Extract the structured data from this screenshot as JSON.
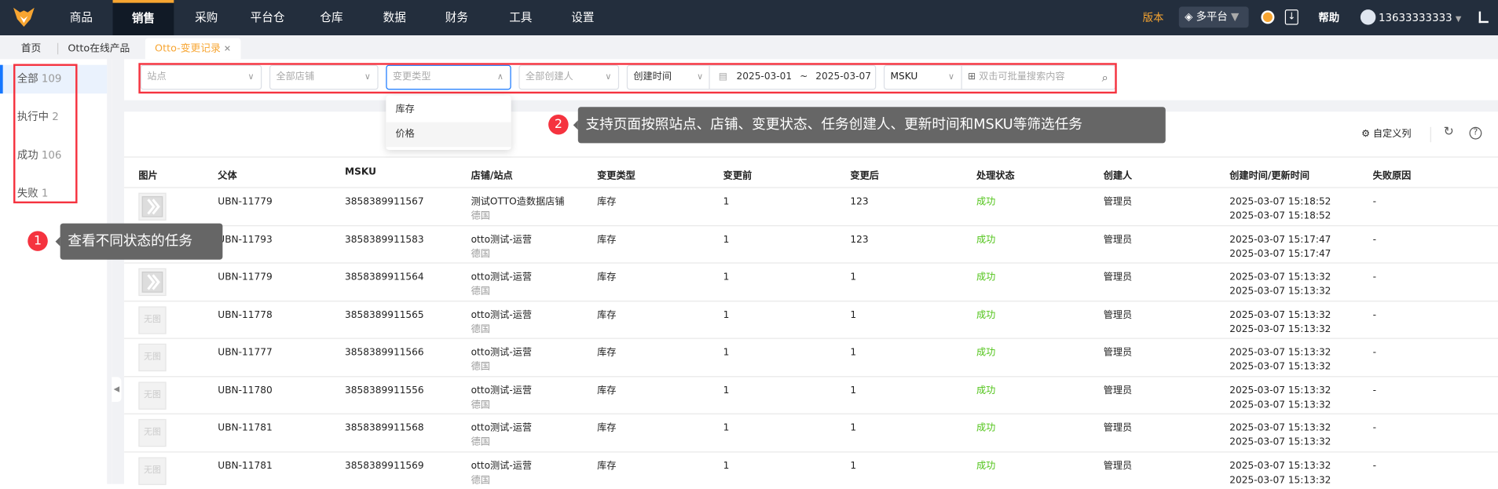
{
  "nav": {
    "items": [
      "商品",
      "销售",
      "采购",
      "平台仓",
      "仓库",
      "数据",
      "财务",
      "工具",
      "设置"
    ],
    "active": 1,
    "version": "版本",
    "platform": "多平台",
    "help": "帮助",
    "user": "13633333333"
  },
  "tabs": [
    {
      "label": "首页"
    },
    {
      "label": "Otto在线产品"
    },
    {
      "label": "Otto-变更记录",
      "close": "✕"
    }
  ],
  "sidebar": [
    {
      "label": "全部",
      "count": "109"
    },
    {
      "label": "执行中",
      "count": "2"
    },
    {
      "label": "成功",
      "count": "106"
    },
    {
      "label": "失败",
      "count": "1"
    }
  ],
  "filters": {
    "site": "站点",
    "store": "全部店铺",
    "type": "变更类型",
    "creator": "全部创建人",
    "time_type": "创建时间",
    "date_from": "2025-03-01",
    "date_sep": "~",
    "date_to": "2025-03-07",
    "search_field": "MSKU",
    "search_placeholder": "双击可批量搜索内容"
  },
  "dropdown": [
    "库存",
    "价格"
  ],
  "annotations": [
    {
      "num": "1",
      "text": "查看不同状态的任务"
    },
    {
      "num": "2",
      "text": "支持页面按照站点、店铺、变更状态、任务创建人、更新时间和MSKU等筛选任务"
    }
  ],
  "toolbar": {
    "custom_columns": "自定义列"
  },
  "columns": [
    "图片",
    "父体",
    "MSKU",
    "店铺/站点",
    "变更类型",
    "变更前",
    "变更后",
    "处理状态",
    "创建人",
    "创建时间/更新时间",
    "失败原因"
  ],
  "rows": [
    {
      "img": "logo",
      "parent": "UBN-11779",
      "msku": "3858389911567",
      "store": "测试OTTO造数据店铺",
      "site": "德国",
      "type": "库存",
      "before": "1",
      "after": "123",
      "status": "成功",
      "creator": "管理员",
      "created": "2025-03-07 15:18:52",
      "updated": "2025-03-07 15:18:52",
      "reason": "-"
    },
    {
      "img": "logo",
      "parent": "UBN-11793",
      "msku": "3858389911583",
      "store": "otto测试-运营",
      "site": "德国",
      "type": "库存",
      "before": "1",
      "after": "123",
      "status": "成功",
      "creator": "管理员",
      "created": "2025-03-07 15:17:47",
      "updated": "2025-03-07 15:17:47",
      "reason": "-"
    },
    {
      "img": "logo",
      "parent": "UBN-11779",
      "msku": "3858389911564",
      "store": "otto测试-运营",
      "site": "德国",
      "type": "库存",
      "before": "1",
      "after": "1",
      "status": "成功",
      "creator": "管理员",
      "created": "2025-03-07 15:13:32",
      "updated": "2025-03-07 15:13:32",
      "reason": "-"
    },
    {
      "img": "无图",
      "parent": "UBN-11778",
      "msku": "3858389911565",
      "store": "otto测试-运营",
      "site": "德国",
      "type": "库存",
      "before": "1",
      "after": "1",
      "status": "成功",
      "creator": "管理员",
      "created": "2025-03-07 15:13:32",
      "updated": "2025-03-07 15:13:32",
      "reason": "-"
    },
    {
      "img": "无图",
      "parent": "UBN-11777",
      "msku": "3858389911566",
      "store": "otto测试-运营",
      "site": "德国",
      "type": "库存",
      "before": "1",
      "after": "1",
      "status": "成功",
      "creator": "管理员",
      "created": "2025-03-07 15:13:32",
      "updated": "2025-03-07 15:13:32",
      "reason": "-"
    },
    {
      "img": "无图",
      "parent": "UBN-11780",
      "msku": "3858389911556",
      "store": "otto测试-运营",
      "site": "德国",
      "type": "库存",
      "before": "1",
      "after": "1",
      "status": "成功",
      "creator": "管理员",
      "created": "2025-03-07 15:13:32",
      "updated": "2025-03-07 15:13:32",
      "reason": "-"
    },
    {
      "img": "无图",
      "parent": "UBN-11781",
      "msku": "3858389911568",
      "store": "otto测试-运营",
      "site": "德国",
      "type": "库存",
      "before": "1",
      "after": "1",
      "status": "成功",
      "creator": "管理员",
      "created": "2025-03-07 15:13:32",
      "updated": "2025-03-07 15:13:32",
      "reason": "-"
    },
    {
      "img": "无图",
      "parent": "UBN-11781",
      "msku": "3858389911569",
      "store": "otto测试-运营",
      "site": "德国",
      "type": "库存",
      "before": "1",
      "after": "1",
      "status": "成功",
      "creator": "管理员",
      "created": "2025-03-07 15:13:32",
      "updated": "2025-03-07 15:13:32",
      "reason": "-"
    }
  ],
  "colors": {
    "accent": "#f7a531",
    "success": "#52c41a",
    "annotation": "#f5333f",
    "nav": "#232e3d"
  }
}
